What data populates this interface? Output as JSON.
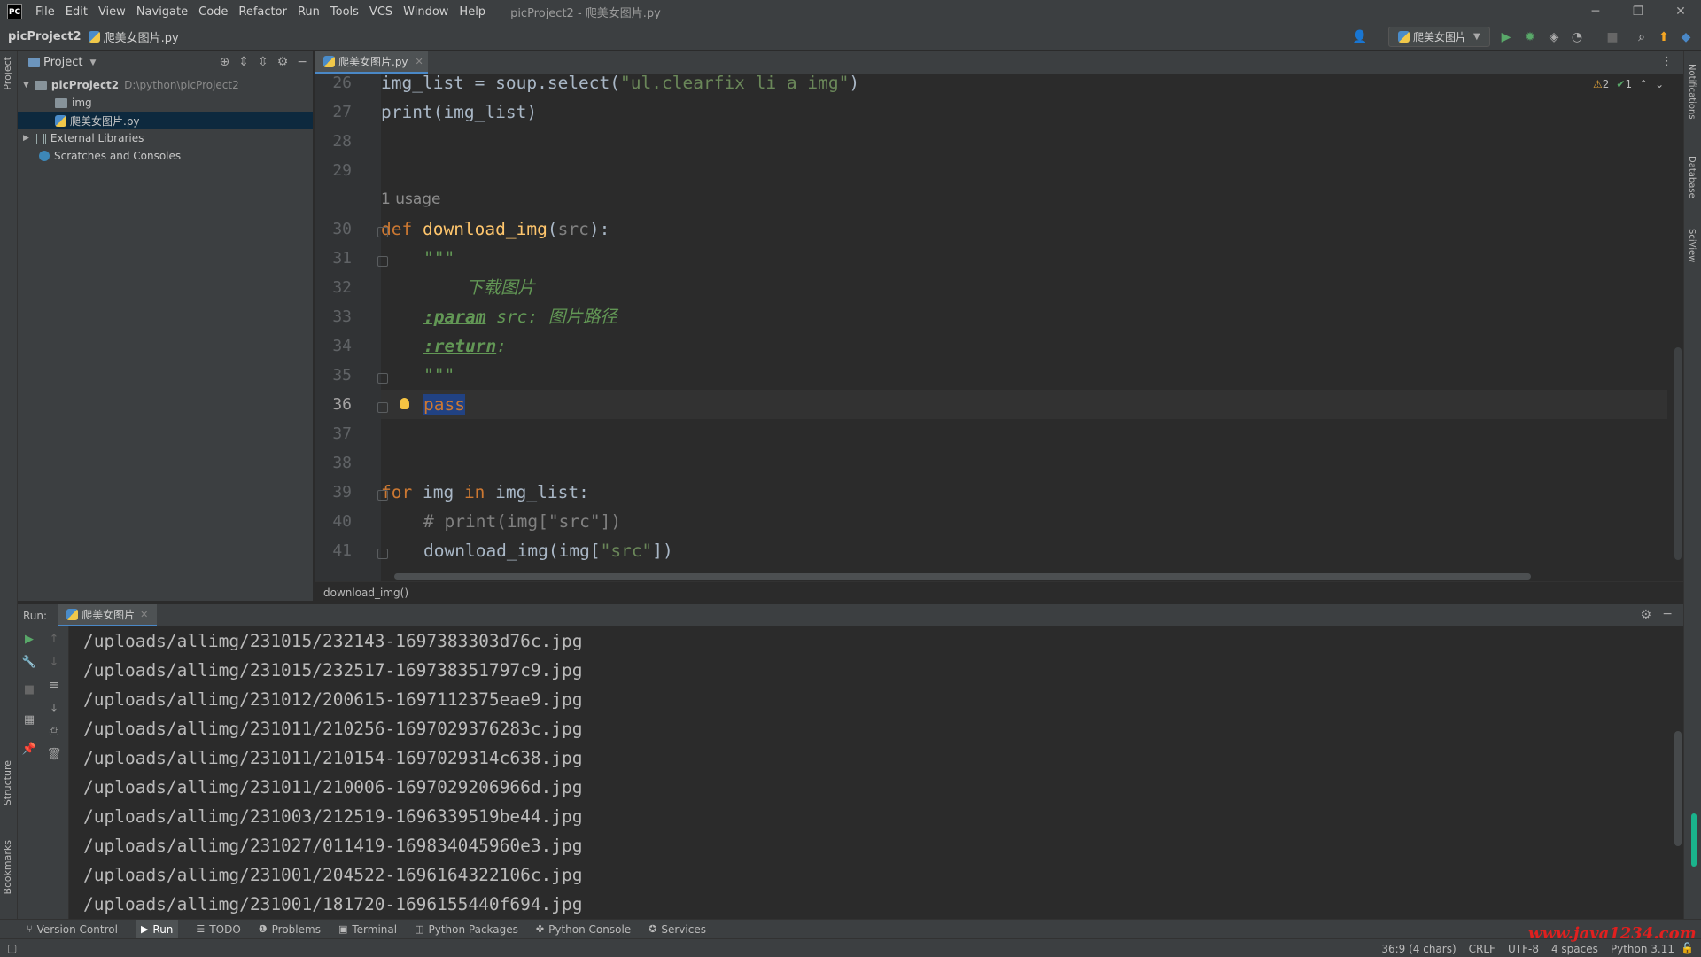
{
  "app": {
    "logo": "PC",
    "window_title": "picProject2 - 爬美女图片.py",
    "menu": [
      "File",
      "Edit",
      "View",
      "Navigate",
      "Code",
      "Refactor",
      "Run",
      "Tools",
      "VCS",
      "Window",
      "Help"
    ],
    "window_controls": [
      "minimize-icon",
      "restore-icon",
      "close-icon"
    ]
  },
  "navbar": {
    "project": "picProject2",
    "file": "爬美女图片.py",
    "run_config": "爬美女图片"
  },
  "project_panel": {
    "title": "Project",
    "tree": [
      {
        "label": "picProject2",
        "path": "D:\\python\\picProject2",
        "type": "project"
      },
      {
        "label": "img",
        "type": "folder"
      },
      {
        "label": "爬美女图片.py",
        "type": "file",
        "selected": true
      },
      {
        "label": "External Libraries",
        "type": "library"
      },
      {
        "label": "Scratches and Consoles",
        "type": "scratch"
      }
    ]
  },
  "editor": {
    "tab": "爬美女图片.py",
    "inspections": {
      "warnings": "2",
      "ok": "1"
    },
    "usage_hint": "1 usage",
    "line_numbers": [
      "26",
      "27",
      "28",
      "29",
      "30",
      "31",
      "32",
      "33",
      "34",
      "35",
      "36",
      "37",
      "38",
      "39",
      "40",
      "41"
    ],
    "current_line": "36",
    "code": {
      "l26_a": "img_list = soup.select(",
      "l26_b": "\"ul.clearfix li a img\"",
      "l26_c": ")",
      "l27": "print(img_list)",
      "l30_kw": "def ",
      "l30_fn": "download_img",
      "l30_a": "(",
      "l30_p": "src",
      "l30_b": "):",
      "l31": "\"\"\"",
      "l32": "下载图片",
      "l33_tag": ":param",
      "l33_rest": " src: 图片路径",
      "l34_tag": ":return",
      "l34_rest": ":",
      "l35": "\"\"\"",
      "l36": "pass",
      "l39_kw1": "for ",
      "l39_a": "img ",
      "l39_kw2": "in ",
      "l39_b": "img_list:",
      "l40": "# print(img[\"src\"])",
      "l41_a": "download_img(img[",
      "l41_b": "\"src\"",
      "l41_c": "])"
    },
    "breadcrumb": "download_img()"
  },
  "run_panel": {
    "label": "Run:",
    "tab": "爬美女图片",
    "output": [
      "/uploads/allimg/231015/232143-1697383303d76c.jpg",
      "/uploads/allimg/231015/232517-169738351797c9.jpg",
      "/uploads/allimg/231012/200615-1697112375eae9.jpg",
      "/uploads/allimg/231011/210256-1697029376283c.jpg",
      "/uploads/allimg/231011/210154-1697029314c638.jpg",
      "/uploads/allimg/231011/210006-1697029206966d.jpg",
      "/uploads/allimg/231003/212519-1696339519be44.jpg",
      "/uploads/allimg/231027/011419-169834045960e3.jpg",
      "/uploads/allimg/231001/204522-1696164322106c.jpg",
      "/uploads/allimg/231001/181720-1696155440f694.jpg"
    ]
  },
  "left_stripe": {
    "project": "Project",
    "structure": "Structure",
    "bookmarks": "Bookmarks"
  },
  "right_stripe": {
    "notifications": "Notifications",
    "database": "Database",
    "sciview": "SciView"
  },
  "bottom_tools": [
    "Version Control",
    "Run",
    "TODO",
    "Problems",
    "Terminal",
    "Python Packages",
    "Python Console",
    "Services"
  ],
  "status": {
    "position": "36:9 (4 chars)",
    "line_sep": "CRLF",
    "encoding": "UTF-8",
    "indent": "4 spaces",
    "interpreter": "Python 3.11"
  },
  "watermark": "www.java1234.com",
  "colors": {
    "accent": "#4a88c7",
    "keyword": "#cc7832",
    "function": "#ffc66d",
    "string": "#6a8759",
    "selection": "#214283"
  }
}
